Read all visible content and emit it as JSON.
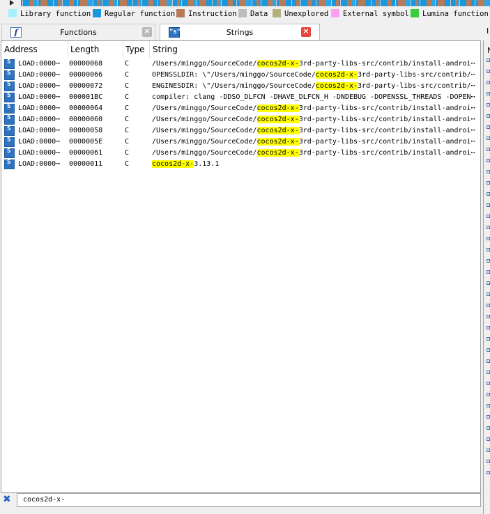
{
  "legend": [
    {
      "label": "Library function",
      "color": "#a8f0ff"
    },
    {
      "label": "Regular function",
      "color": "#1b97de"
    },
    {
      "label": "Instruction",
      "color": "#b97a57"
    },
    {
      "label": "Data",
      "color": "#bdbdbd"
    },
    {
      "label": "Unexplored",
      "color": "#b4b27a"
    },
    {
      "label": "External symbol",
      "color": "#ff9ef0"
    },
    {
      "label": "Lumina function",
      "color": "#39cc3d"
    }
  ],
  "tabs": [
    {
      "label": "Functions",
      "icon": "function-icon",
      "glyph": "f",
      "active": false
    },
    {
      "label": "Strings",
      "icon": "string-icon",
      "glyph": "\"s\"",
      "active": true
    }
  ],
  "right_edge": {
    "tab_letter": "I",
    "panel_letter": "N"
  },
  "columns": [
    "Address",
    "Length",
    "Type",
    "String"
  ],
  "rows": [
    {
      "address": "LOAD:0000⋯",
      "length": "00000068",
      "type": "C",
      "pre": "/Users/minggo/SourceCode/",
      "match": "cocos2d-x-",
      "post": "3rd-party-libs-src/contrib/install-androi⋯"
    },
    {
      "address": "LOAD:0000⋯",
      "length": "00000066",
      "type": "C",
      "pre": "OPENSSLDIR: \\\"/Users/minggo/SourceCode/",
      "match": "cocos2d-x-",
      "post": "3rd-party-libs-src/contrib/⋯"
    },
    {
      "address": "LOAD:0000⋯",
      "length": "00000072",
      "type": "C",
      "pre": "ENGINESDIR: \\\"/Users/minggo/SourceCode/",
      "match": "cocos2d-x-",
      "post": "3rd-party-libs-src/contrib/⋯"
    },
    {
      "address": "LOAD:0000⋯",
      "length": "000001BC",
      "type": "C",
      "pre": "compiler: clang -DDSO_DLFCN -DHAVE_DLFCN_H -DNDEBUG -DOPENSSL_THREADS -DOPEN⋯",
      "match": "",
      "post": ""
    },
    {
      "address": "LOAD:0000⋯",
      "length": "00000064",
      "type": "C",
      "pre": "/Users/minggo/SourceCode/",
      "match": "cocos2d-x-",
      "post": "3rd-party-libs-src/contrib/install-androi⋯"
    },
    {
      "address": "LOAD:0000⋯",
      "length": "00000060",
      "type": "C",
      "pre": "/Users/minggo/SourceCode/",
      "match": "cocos2d-x-",
      "post": "3rd-party-libs-src/contrib/install-androi⋯"
    },
    {
      "address": "LOAD:0000⋯",
      "length": "00000058",
      "type": "C",
      "pre": "/Users/minggo/SourceCode/",
      "match": "cocos2d-x-",
      "post": "3rd-party-libs-src/contrib/install-androi⋯"
    },
    {
      "address": "LOAD:0000⋯",
      "length": "0000005E",
      "type": "C",
      "pre": "/Users/minggo/SourceCode/",
      "match": "cocos2d-x-",
      "post": "3rd-party-libs-src/contrib/install-androi⋯"
    },
    {
      "address": "LOAD:0000⋯",
      "length": "00000061",
      "type": "C",
      "pre": "/Users/minggo/SourceCode/",
      "match": "cocos2d-x-",
      "post": "3rd-party-libs-src/contrib/install-androi⋯"
    },
    {
      "address": "LOAD:0000⋯",
      "length": "00000011",
      "type": "C",
      "pre": "",
      "match": "cocos2d-x-",
      "post": "3.13.1"
    }
  ],
  "search": {
    "value": "cocos2d-x-",
    "close_icon": "close-icon"
  }
}
